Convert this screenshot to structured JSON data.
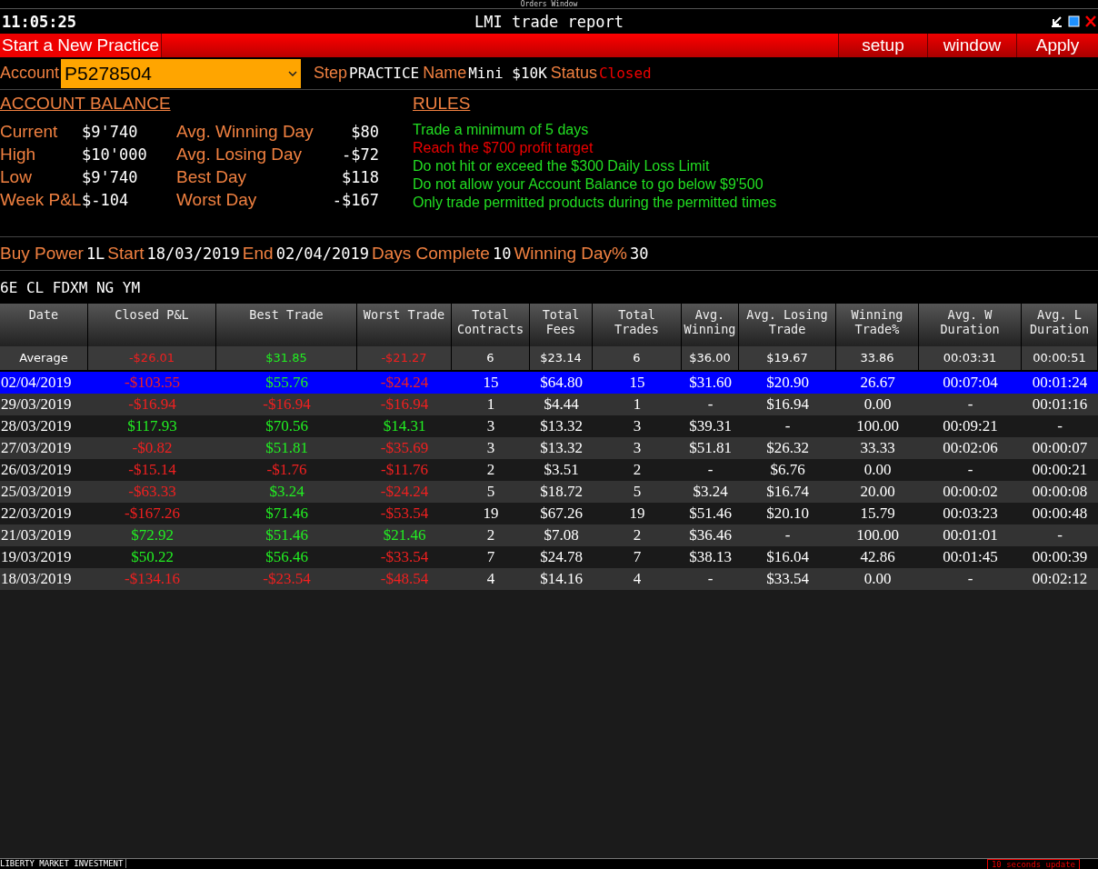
{
  "top_strip": {
    "title": "Orders Window"
  },
  "window": {
    "time": "11:05:25",
    "title": "LMI trade report"
  },
  "menu": {
    "left": "Start a New Practice",
    "buttons": [
      "setup",
      "window",
      "Apply"
    ]
  },
  "account_bar": {
    "account_label": "Account",
    "account_value": "P5278504",
    "step_label": "Step",
    "step_value": "PRACTICE",
    "name_label": "Name",
    "name_value": "Mini $10K",
    "status_label": "Status",
    "status_value": "Closed"
  },
  "account_balance": {
    "heading": "ACCOUNT BALANCE",
    "left": [
      {
        "label": "Current",
        "value": "$9'740"
      },
      {
        "label": "High",
        "value": "$10'000"
      },
      {
        "label": "Low",
        "value": "$9'740"
      },
      {
        "label": "Week P&L",
        "value": "$-104"
      }
    ],
    "right": [
      {
        "label": "Avg. Winning Day",
        "value": "$80"
      },
      {
        "label": "Avg. Losing Day",
        "value": "-$72"
      },
      {
        "label": "Best Day",
        "value": "$118"
      },
      {
        "label": "Worst Day",
        "value": "-$167"
      }
    ]
  },
  "rules": {
    "heading": "RULES",
    "items": [
      {
        "text": "Trade a minimum of 5 days",
        "met": true
      },
      {
        "text": "Reach the $700 profit target",
        "met": false
      },
      {
        "text": "Do not hit or exceed the $300 Daily Loss Limit",
        "met": true
      },
      {
        "text": "Do not allow your Account Balance to go below $9'500",
        "met": true
      },
      {
        "text": "Only trade permitted products during the permitted times",
        "met": true
      }
    ]
  },
  "summary": [
    {
      "label": "Buy Power",
      "value": "1L"
    },
    {
      "label": "Start",
      "value": "18/03/2019"
    },
    {
      "label": "End",
      "value": "02/04/2019"
    },
    {
      "label": "Days Complete",
      "value": "10"
    },
    {
      "label": "Winning Day%",
      "value": "30"
    }
  ],
  "products": "6E CL FDXM NG YM",
  "table": {
    "columns": [
      "Date",
      "Closed P&L",
      "Best Trade",
      "Worst Trade",
      "Total Contracts",
      "Total Fees",
      "Total Trades",
      "Avg. Winning",
      "Avg. Losing Trade",
      "Winning Trade%",
      "Avg. W Duration",
      "Avg. L Duration"
    ],
    "average": [
      {
        "text": "Average",
        "kind": "plain"
      },
      {
        "text": "-$26.01",
        "kind": "loss"
      },
      {
        "text": "$31.85",
        "kind": "gain"
      },
      {
        "text": "-$21.27",
        "kind": "loss"
      },
      {
        "text": "6",
        "kind": "plain"
      },
      {
        "text": "$23.14",
        "kind": "plain"
      },
      {
        "text": "6",
        "kind": "plain"
      },
      {
        "text": "$36.00",
        "kind": "plain"
      },
      {
        "text": "$19.67",
        "kind": "plain"
      },
      {
        "text": "33.86",
        "kind": "plain"
      },
      {
        "text": "00:03:31",
        "kind": "plain"
      },
      {
        "text": "00:00:51",
        "kind": "plain"
      }
    ],
    "rows": [
      {
        "selected": true,
        "cells": [
          {
            "text": "02/04/2019",
            "kind": "plain"
          },
          {
            "text": "-$103.55",
            "kind": "loss"
          },
          {
            "text": "$55.76",
            "kind": "gain"
          },
          {
            "text": "-$24.24",
            "kind": "loss"
          },
          {
            "text": "15",
            "kind": "plain"
          },
          {
            "text": "$64.80",
            "kind": "plain"
          },
          {
            "text": "15",
            "kind": "plain"
          },
          {
            "text": "$31.60",
            "kind": "plain"
          },
          {
            "text": "$20.90",
            "kind": "plain"
          },
          {
            "text": "26.67",
            "kind": "plain"
          },
          {
            "text": "00:07:04",
            "kind": "plain"
          },
          {
            "text": "00:01:24",
            "kind": "plain"
          }
        ]
      },
      {
        "selected": false,
        "cells": [
          {
            "text": "29/03/2019",
            "kind": "plain"
          },
          {
            "text": "-$16.94",
            "kind": "loss"
          },
          {
            "text": "-$16.94",
            "kind": "loss"
          },
          {
            "text": "-$16.94",
            "kind": "loss"
          },
          {
            "text": "1",
            "kind": "plain"
          },
          {
            "text": "$4.44",
            "kind": "plain"
          },
          {
            "text": "1",
            "kind": "plain"
          },
          {
            "text": "-",
            "kind": "plain"
          },
          {
            "text": "$16.94",
            "kind": "plain"
          },
          {
            "text": "0.00",
            "kind": "plain"
          },
          {
            "text": "-",
            "kind": "plain"
          },
          {
            "text": "00:01:16",
            "kind": "plain"
          }
        ]
      },
      {
        "selected": false,
        "cells": [
          {
            "text": "28/03/2019",
            "kind": "plain"
          },
          {
            "text": "$117.93",
            "kind": "gain"
          },
          {
            "text": "$70.56",
            "kind": "gain"
          },
          {
            "text": "$14.31",
            "kind": "gain"
          },
          {
            "text": "3",
            "kind": "plain"
          },
          {
            "text": "$13.32",
            "kind": "plain"
          },
          {
            "text": "3",
            "kind": "plain"
          },
          {
            "text": "$39.31",
            "kind": "plain"
          },
          {
            "text": "-",
            "kind": "plain"
          },
          {
            "text": "100.00",
            "kind": "plain"
          },
          {
            "text": "00:09:21",
            "kind": "plain"
          },
          {
            "text": "-",
            "kind": "plain"
          }
        ]
      },
      {
        "selected": false,
        "cells": [
          {
            "text": "27/03/2019",
            "kind": "plain"
          },
          {
            "text": "-$0.82",
            "kind": "loss"
          },
          {
            "text": "$51.81",
            "kind": "gain"
          },
          {
            "text": "-$35.69",
            "kind": "loss"
          },
          {
            "text": "3",
            "kind": "plain"
          },
          {
            "text": "$13.32",
            "kind": "plain"
          },
          {
            "text": "3",
            "kind": "plain"
          },
          {
            "text": "$51.81",
            "kind": "plain"
          },
          {
            "text": "$26.32",
            "kind": "plain"
          },
          {
            "text": "33.33",
            "kind": "plain"
          },
          {
            "text": "00:02:06",
            "kind": "plain"
          },
          {
            "text": "00:00:07",
            "kind": "plain"
          }
        ]
      },
      {
        "selected": false,
        "cells": [
          {
            "text": "26/03/2019",
            "kind": "plain"
          },
          {
            "text": "-$15.14",
            "kind": "loss"
          },
          {
            "text": "-$1.76",
            "kind": "loss"
          },
          {
            "text": "-$11.76",
            "kind": "loss"
          },
          {
            "text": "2",
            "kind": "plain"
          },
          {
            "text": "$3.51",
            "kind": "plain"
          },
          {
            "text": "2",
            "kind": "plain"
          },
          {
            "text": "-",
            "kind": "plain"
          },
          {
            "text": "$6.76",
            "kind": "plain"
          },
          {
            "text": "0.00",
            "kind": "plain"
          },
          {
            "text": "-",
            "kind": "plain"
          },
          {
            "text": "00:00:21",
            "kind": "plain"
          }
        ]
      },
      {
        "selected": false,
        "cells": [
          {
            "text": "25/03/2019",
            "kind": "plain"
          },
          {
            "text": "-$63.33",
            "kind": "loss"
          },
          {
            "text": "$3.24",
            "kind": "gain"
          },
          {
            "text": "-$24.24",
            "kind": "loss"
          },
          {
            "text": "5",
            "kind": "plain"
          },
          {
            "text": "$18.72",
            "kind": "plain"
          },
          {
            "text": "5",
            "kind": "plain"
          },
          {
            "text": "$3.24",
            "kind": "plain"
          },
          {
            "text": "$16.74",
            "kind": "plain"
          },
          {
            "text": "20.00",
            "kind": "plain"
          },
          {
            "text": "00:00:02",
            "kind": "plain"
          },
          {
            "text": "00:00:08",
            "kind": "plain"
          }
        ]
      },
      {
        "selected": false,
        "cells": [
          {
            "text": "22/03/2019",
            "kind": "plain"
          },
          {
            "text": "-$167.26",
            "kind": "loss"
          },
          {
            "text": "$71.46",
            "kind": "gain"
          },
          {
            "text": "-$53.54",
            "kind": "loss"
          },
          {
            "text": "19",
            "kind": "plain"
          },
          {
            "text": "$67.26",
            "kind": "plain"
          },
          {
            "text": "19",
            "kind": "plain"
          },
          {
            "text": "$51.46",
            "kind": "plain"
          },
          {
            "text": "$20.10",
            "kind": "plain"
          },
          {
            "text": "15.79",
            "kind": "plain"
          },
          {
            "text": "00:03:23",
            "kind": "plain"
          },
          {
            "text": "00:00:48",
            "kind": "plain"
          }
        ]
      },
      {
        "selected": false,
        "cells": [
          {
            "text": "21/03/2019",
            "kind": "plain"
          },
          {
            "text": "$72.92",
            "kind": "gain"
          },
          {
            "text": "$51.46",
            "kind": "gain"
          },
          {
            "text": "$21.46",
            "kind": "gain"
          },
          {
            "text": "2",
            "kind": "plain"
          },
          {
            "text": "$7.08",
            "kind": "plain"
          },
          {
            "text": "2",
            "kind": "plain"
          },
          {
            "text": "$36.46",
            "kind": "plain"
          },
          {
            "text": "-",
            "kind": "plain"
          },
          {
            "text": "100.00",
            "kind": "plain"
          },
          {
            "text": "00:01:01",
            "kind": "plain"
          },
          {
            "text": "-",
            "kind": "plain"
          }
        ]
      },
      {
        "selected": false,
        "cells": [
          {
            "text": "19/03/2019",
            "kind": "plain"
          },
          {
            "text": "$50.22",
            "kind": "gain"
          },
          {
            "text": "$56.46",
            "kind": "gain"
          },
          {
            "text": "-$33.54",
            "kind": "loss"
          },
          {
            "text": "7",
            "kind": "plain"
          },
          {
            "text": "$24.78",
            "kind": "plain"
          },
          {
            "text": "7",
            "kind": "plain"
          },
          {
            "text": "$38.13",
            "kind": "plain"
          },
          {
            "text": "$16.04",
            "kind": "plain"
          },
          {
            "text": "42.86",
            "kind": "plain"
          },
          {
            "text": "00:01:45",
            "kind": "plain"
          },
          {
            "text": "00:00:39",
            "kind": "plain"
          }
        ]
      },
      {
        "selected": false,
        "cells": [
          {
            "text": "18/03/2019",
            "kind": "plain"
          },
          {
            "text": "-$134.16",
            "kind": "loss"
          },
          {
            "text": "-$23.54",
            "kind": "loss"
          },
          {
            "text": "-$48.54",
            "kind": "loss"
          },
          {
            "text": "4",
            "kind": "plain"
          },
          {
            "text": "$14.16",
            "kind": "plain"
          },
          {
            "text": "4",
            "kind": "plain"
          },
          {
            "text": "-",
            "kind": "plain"
          },
          {
            "text": "$33.54",
            "kind": "plain"
          },
          {
            "text": "0.00",
            "kind": "plain"
          },
          {
            "text": "-",
            "kind": "plain"
          },
          {
            "text": "00:02:12",
            "kind": "plain"
          }
        ]
      }
    ]
  },
  "status_bar": {
    "left": "LIBERTY MARKET INVESTMENT",
    "right": "10 seconds update"
  }
}
